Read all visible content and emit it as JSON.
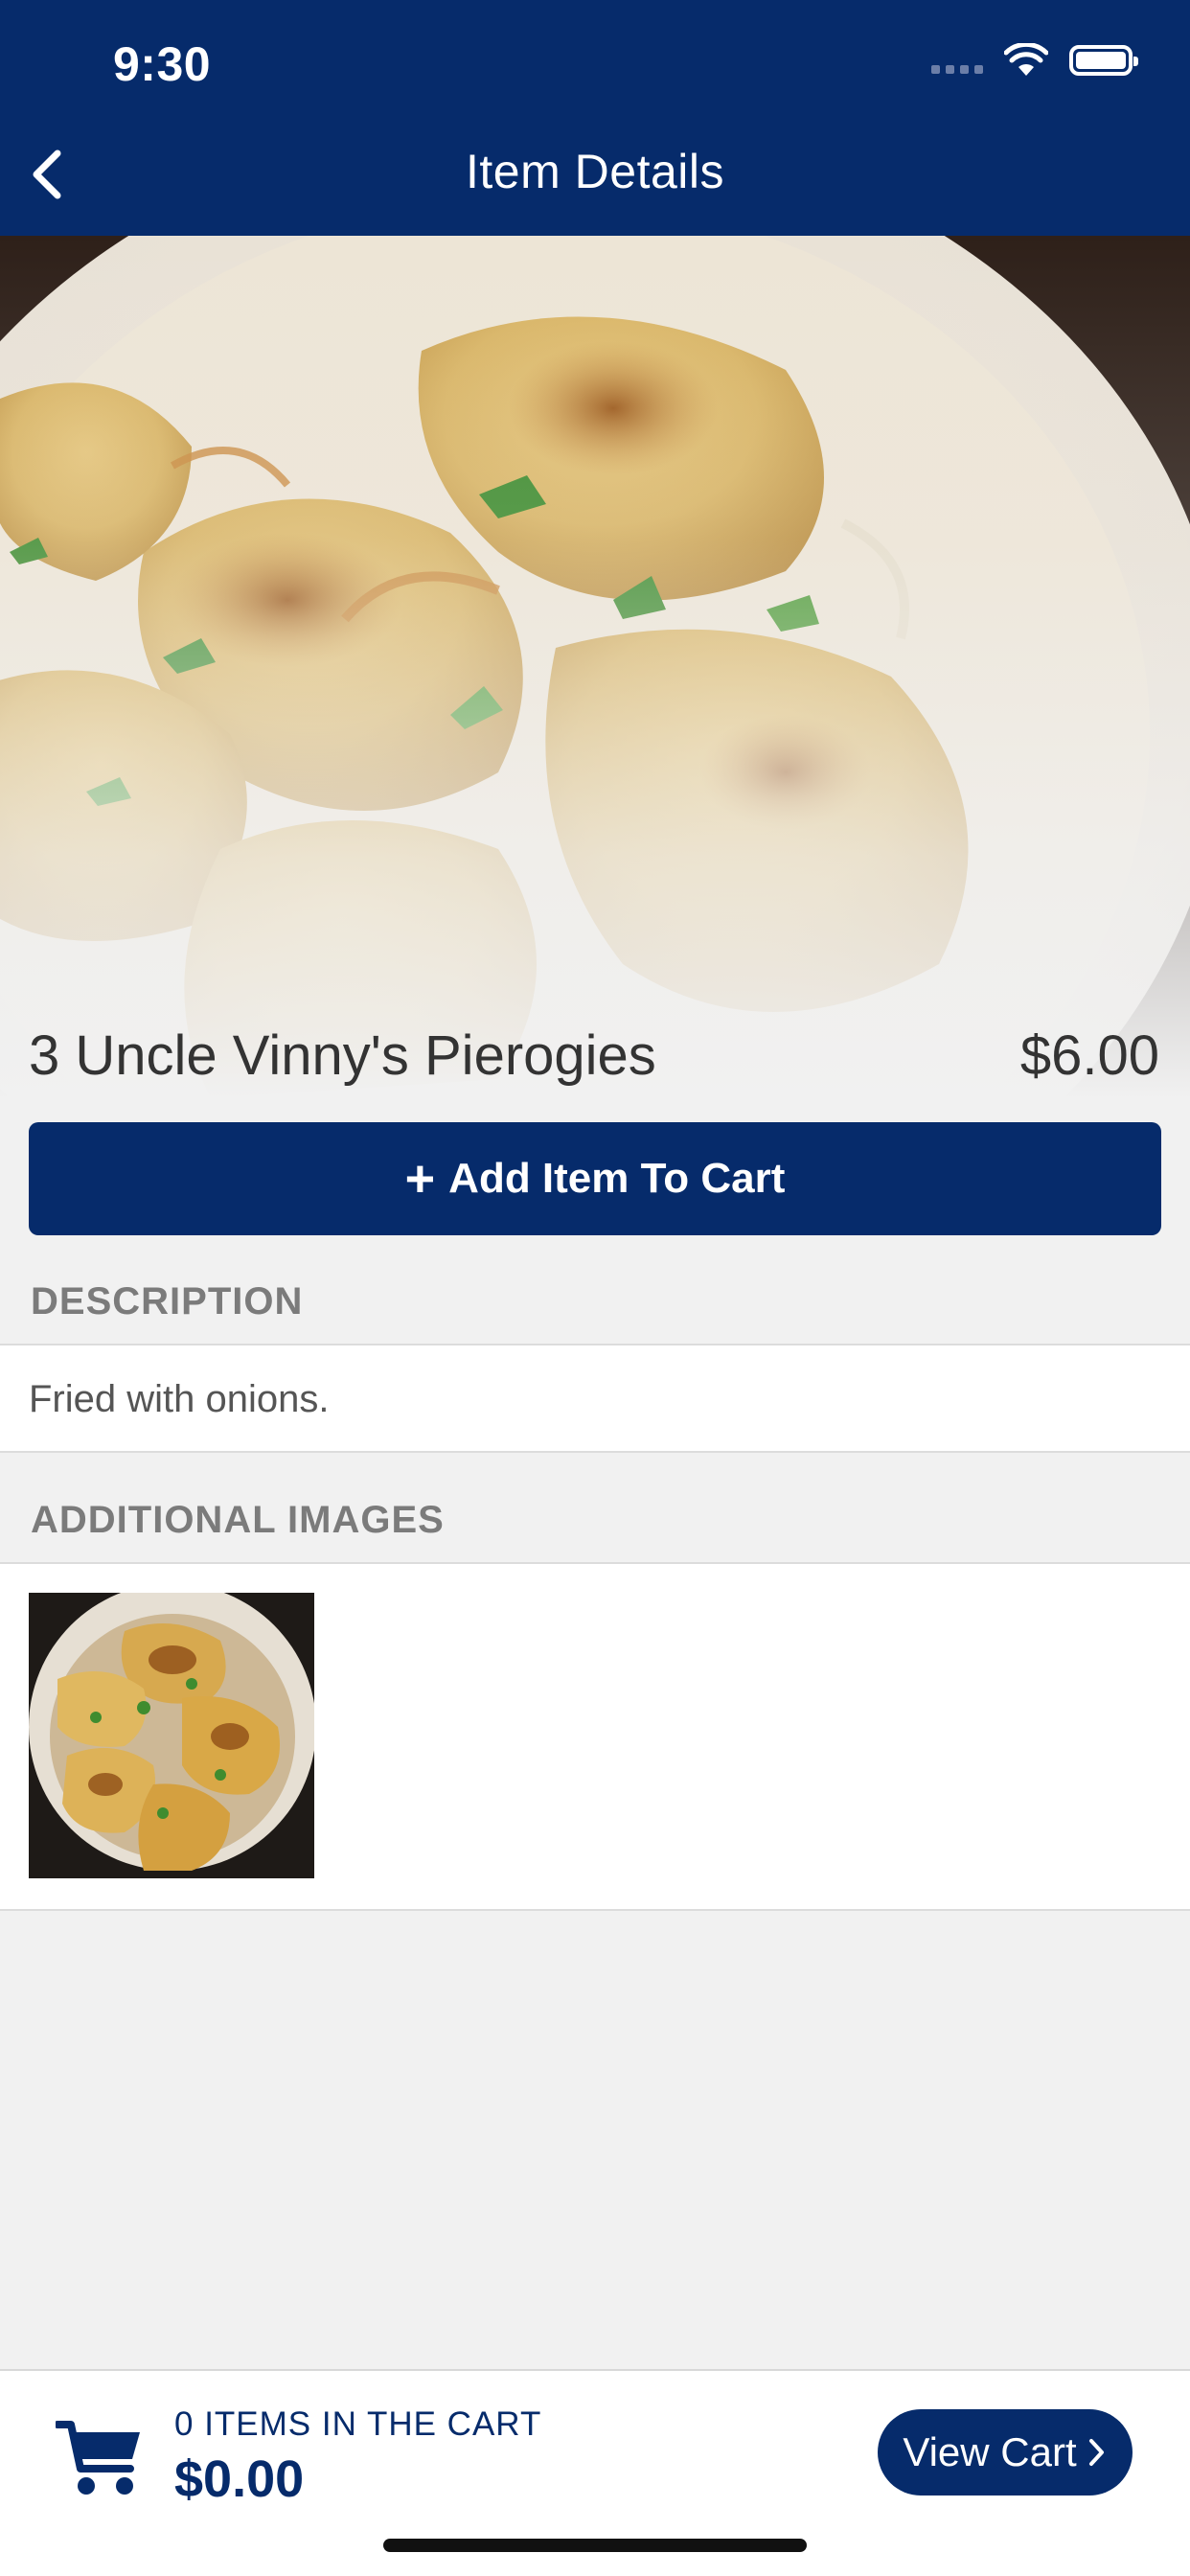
{
  "status_bar": {
    "time": "9:30"
  },
  "header": {
    "title": "Item Details"
  },
  "item": {
    "name": "3 Uncle Vinny's Pierogies",
    "price": "$6.00",
    "add_button_label": "Add Item To Cart"
  },
  "description": {
    "header": "DESCRIPTION",
    "text": "Fried with onions."
  },
  "additional_images": {
    "header": "ADDITIONAL IMAGES"
  },
  "cart": {
    "count_label": "0 ITEMS IN THE CART",
    "total": "$0.00",
    "view_cart_label": "View Cart"
  },
  "colors": {
    "brand": "#062b6b",
    "background": "#f1f1f1"
  }
}
